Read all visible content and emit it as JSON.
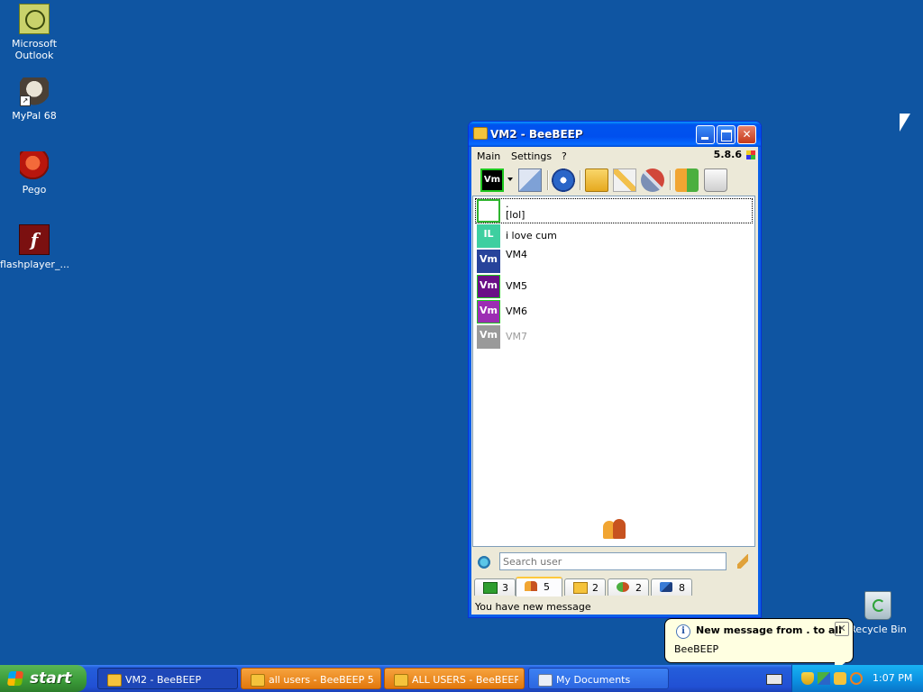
{
  "desktop": {
    "icons": [
      {
        "label": "Microsoft Outlook",
        "icon": "outlook-icon"
      },
      {
        "label": "MyPal 68",
        "icon": "mypal-icon"
      },
      {
        "label": "Pego",
        "icon": "pego-icon"
      },
      {
        "label": "flashplayer_...",
        "icon": "flash-icon"
      }
    ],
    "recycle_bin": "Recycle Bin"
  },
  "window": {
    "title": "VM2 - BeeBEEP",
    "menu": [
      "Main",
      "Settings",
      "?"
    ],
    "version": "5.8.6",
    "toolbar_avatar": "Vm",
    "users": [
      {
        "name": ".",
        "status": "[lol]",
        "avatar": "",
        "color": "#ffffff",
        "border": "#2fb52f",
        "selected": true
      },
      {
        "name": "i love cum",
        "status": "",
        "avatar": "IL",
        "color": "#3ecfa0",
        "border": "#3ecfa0",
        "selected": false
      },
      {
        "name": "VM4",
        "status": "",
        "avatar": "Vm",
        "color": "#27439b",
        "border": "#27439b",
        "selected": false
      },
      {
        "name": "VM5",
        "status": "",
        "avatar": "Vm",
        "color": "#6a0f86",
        "border": "#6a0f86",
        "selected": false
      },
      {
        "name": "VM6",
        "status": "",
        "avatar": "Vm",
        "color": "#9c2db3",
        "border": "#9c2db3",
        "selected": false
      },
      {
        "name": "VM7",
        "status": "",
        "avatar": "Vm",
        "color": "#9a9a9a",
        "border": "#9a9a9a",
        "selected": false,
        "offline": true
      }
    ],
    "search_placeholder": "Search user",
    "tabs": [
      {
        "icon": "chat-icon",
        "count": "3"
      },
      {
        "icon": "users-icon",
        "count": "5"
      },
      {
        "icon": "group-icon",
        "count": "2"
      },
      {
        "icon": "network-icon",
        "count": "2"
      },
      {
        "icon": "pin-icon",
        "count": "8"
      }
    ],
    "status": "You have new message"
  },
  "balloon": {
    "title": "New message from . to all",
    "body": "BeeBEEP"
  },
  "taskbar": {
    "start": "start",
    "tasks": [
      {
        "label": "VM2 - BeeBEEP",
        "style": "active"
      },
      {
        "label": "all users - BeeBEEP 5....",
        "style": "orange"
      },
      {
        "label": "ALL USERS - BeeBEEP...",
        "style": "orange"
      },
      {
        "label": "My Documents",
        "style": "normal"
      }
    ],
    "clock": "1:07 PM"
  }
}
